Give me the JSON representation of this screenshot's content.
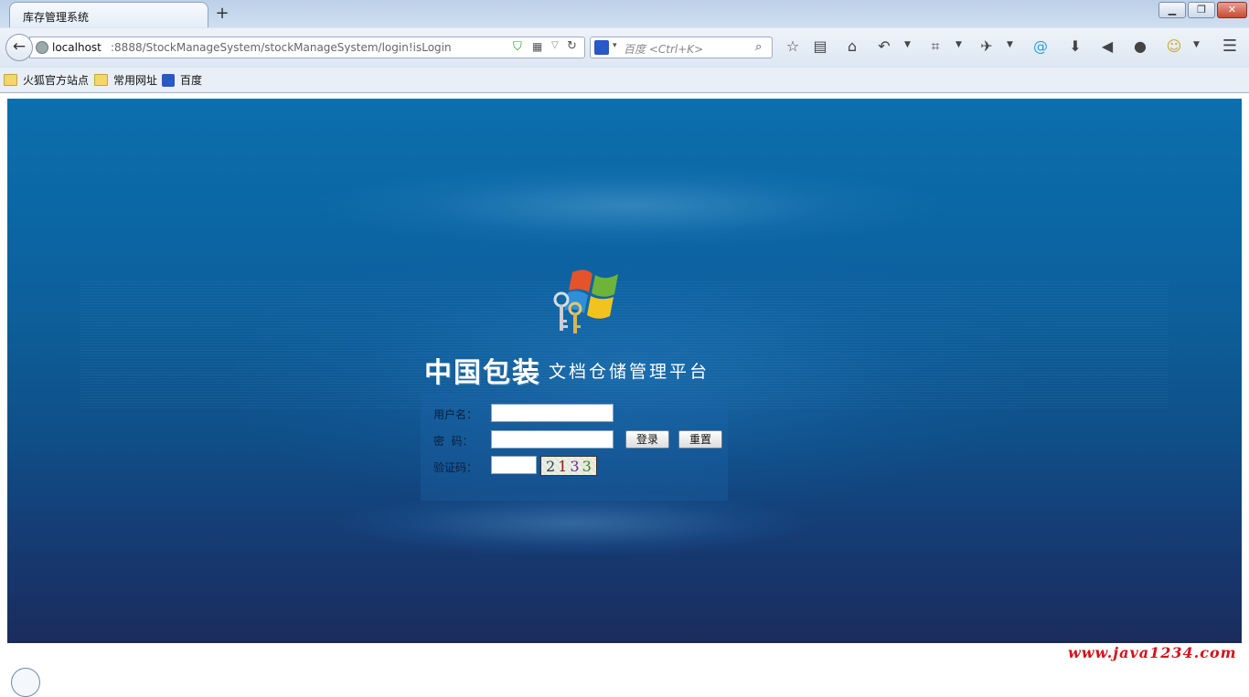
{
  "browser": {
    "tab_title": "库存管理系统",
    "new_tab_label": "+",
    "url_host": "localhost",
    "url_path": ":8888/StockManageSystem/stockManageSystem/login!isLogin",
    "search_placeholder": "百度 <Ctrl+K>",
    "bookmarks": [
      {
        "label": "火狐官方站点",
        "icon": "folder-icon"
      },
      {
        "label": "常用网址",
        "icon": "folder-icon"
      },
      {
        "label": "百度",
        "icon": "baidu-paw-icon"
      }
    ],
    "toolbar_icons": [
      "bookmark-star-icon",
      "reading-list-icon",
      "home-icon",
      "undo-icon",
      "crop-icon",
      "extension-icon",
      "at-icon",
      "download-icon",
      "speaker-icon",
      "user-icon",
      "emoji-icon",
      "menu-icon"
    ]
  },
  "login": {
    "brand_main": "中国包装",
    "brand_sub": "文档仓储管理平台",
    "username_label": "用户名：",
    "password_label": "密  码：",
    "captcha_label": "验证码：",
    "login_button": "登录",
    "reset_button": "重置",
    "captcha_digits": [
      "2",
      "1",
      "3",
      "3"
    ],
    "username_value": "",
    "password_value": "",
    "captcha_value": ""
  },
  "footer": {
    "watermark": "www.java1234.com"
  },
  "colors": {
    "page_bg_top": "#0c6fae",
    "page_bg_bottom": "#1a2c5c",
    "watermark": "#d4121a"
  }
}
